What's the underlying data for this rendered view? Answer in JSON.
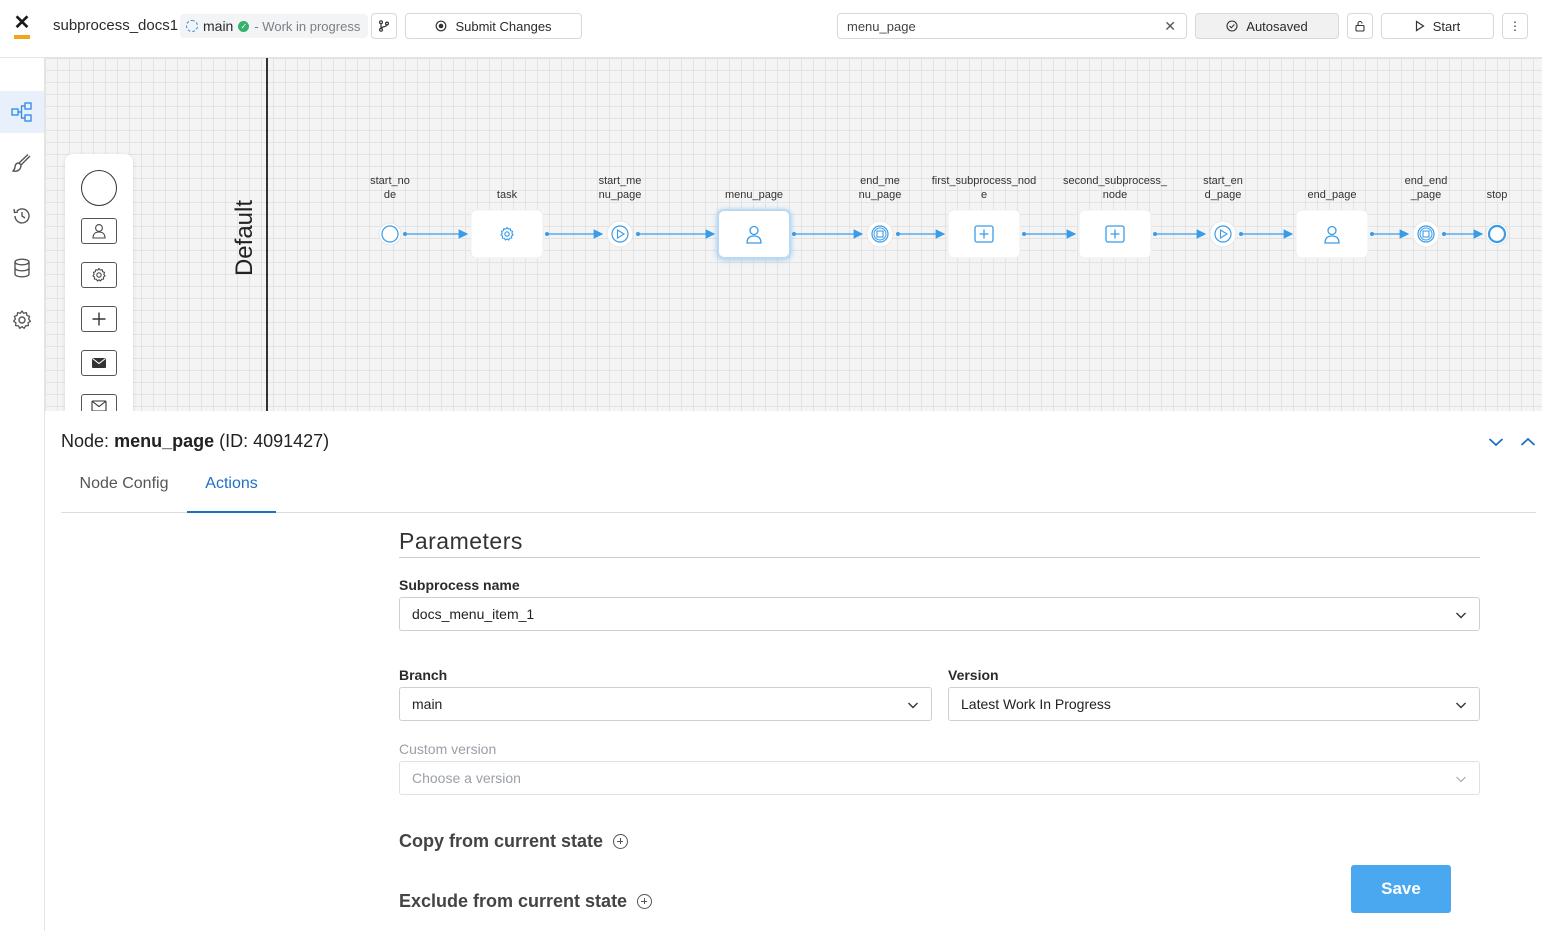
{
  "header": {
    "process_name": "subprocess_docs1",
    "branch": "main",
    "status": "- Work in progress",
    "submit_label": "Submit Changes",
    "search_value": "menu_page",
    "autosaved_label": "Autosaved",
    "start_label": "Start"
  },
  "sidebar": {
    "items": [
      {
        "name": "process-flow-icon",
        "active": true
      },
      {
        "name": "brush-icon",
        "active": false
      },
      {
        "name": "history-icon",
        "active": false
      },
      {
        "name": "database-icon",
        "active": false
      },
      {
        "name": "gear-icon",
        "active": false
      }
    ]
  },
  "canvas": {
    "lane_label": "Default",
    "palette": [
      "start-event",
      "user-task",
      "service-task",
      "subprocess",
      "message-send",
      "message-receive"
    ],
    "nodes": [
      {
        "id": "start_node",
        "label_lines": [
          "start_no",
          "de"
        ],
        "kind": "start"
      },
      {
        "id": "task",
        "label_lines": [
          "task"
        ],
        "kind": "service"
      },
      {
        "id": "start_menu_page",
        "label_lines": [
          "start_me",
          "nu_page"
        ],
        "kind": "start-milestone"
      },
      {
        "id": "menu_page",
        "label_lines": [
          "menu_page"
        ],
        "kind": "user",
        "selected": true
      },
      {
        "id": "end_menu_page",
        "label_lines": [
          "end_me",
          "nu_page"
        ],
        "kind": "end-milestone"
      },
      {
        "id": "first_subprocess_node",
        "label_lines": [
          "first_subprocess_nod",
          "e"
        ],
        "kind": "subprocess"
      },
      {
        "id": "second_subprocess_node",
        "label_lines": [
          "second_subprocess_",
          "node"
        ],
        "kind": "subprocess"
      },
      {
        "id": "start_end_page",
        "label_lines": [
          "start_en",
          "d_page"
        ],
        "kind": "start-milestone"
      },
      {
        "id": "end_page",
        "label_lines": [
          "end_page"
        ],
        "kind": "user"
      },
      {
        "id": "end_end_page",
        "label_lines": [
          "end_end",
          "_page"
        ],
        "kind": "end-milestone"
      },
      {
        "id": "stop",
        "label_lines": [
          "stop"
        ],
        "kind": "end"
      }
    ]
  },
  "panel": {
    "node_prefix": "Node:",
    "node_name": "menu_page",
    "node_id_text": "(ID: 4091427)",
    "tabs": [
      {
        "label": "Node Config",
        "active": false
      },
      {
        "label": "Actions",
        "active": true
      }
    ],
    "section_title": "Parameters",
    "subprocess_name_label": "Subprocess name",
    "subprocess_name_value": "docs_menu_item_1",
    "branch_label": "Branch",
    "branch_value": "main",
    "version_label": "Version",
    "version_value": "Latest Work In Progress",
    "custom_version_label": "Custom version",
    "custom_version_placeholder": "Choose a version",
    "copy_label": "Copy from current state",
    "exclude_label": "Exclude from current state",
    "save_label": "Save"
  },
  "colors": {
    "accent": "#1f6fc5",
    "node_icon": "#3a9be8",
    "save_button": "#4aa8f0",
    "status_ok": "#35b26b",
    "logo_bar": "#f2a516"
  }
}
